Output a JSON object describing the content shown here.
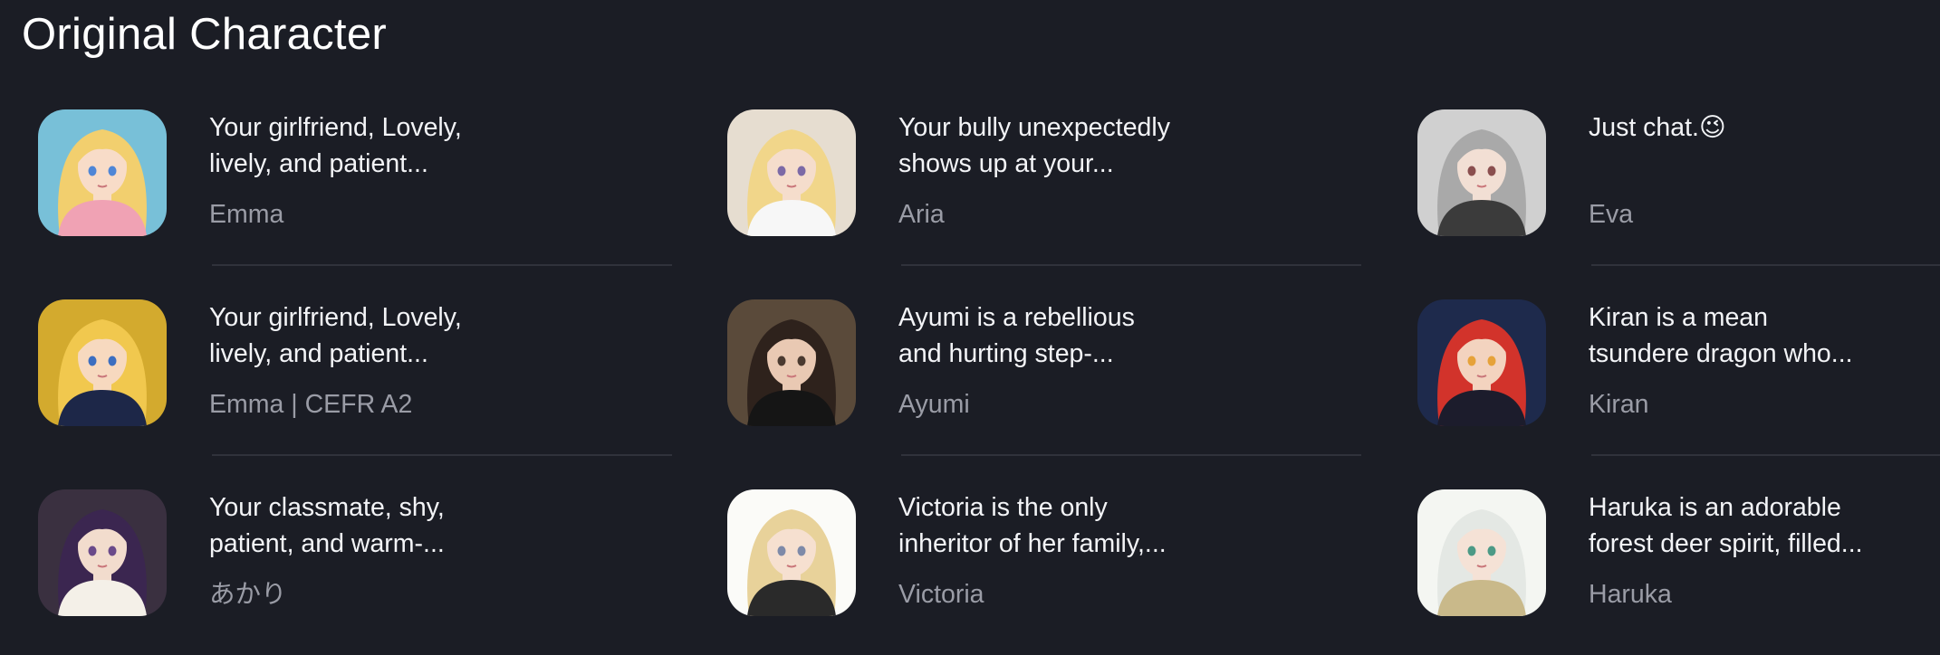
{
  "section": {
    "title": "Original Character"
  },
  "characters": [
    {
      "description_lines": [
        "Your girlfriend, Lovely,",
        "lively, and patient..."
      ],
      "name": "Emma",
      "avatar_icon": "avatar-blonde-girl-pink-top",
      "colors": {
        "bg": "#78c0d8",
        "hair": "#f2cf6e",
        "skin": "#f8dcc8",
        "clothes": "#f0a2b4",
        "eyes": "#4f86d6"
      }
    },
    {
      "description_lines": [
        "Your bully unexpectedly",
        "shows up at your..."
      ],
      "name": "Aria",
      "avatar_icon": "avatar-blonde-woman-white-top",
      "colors": {
        "bg": "#e6ddd0",
        "hair": "#f1d68a",
        "skin": "#f5ddcc",
        "clothes": "#f7f7f7",
        "eyes": "#7c6aa6"
      }
    },
    {
      "description_lines": [
        "Just chat.😉"
      ],
      "name": "Eva",
      "avatar_icon": "avatar-silver-hair-woman",
      "colors": {
        "bg": "#d0d0d0",
        "hair": "#a9a9a9",
        "skin": "#f2dfd4",
        "clothes": "#3b3b3b",
        "eyes": "#8a4f4f"
      }
    },
    {
      "description_lines": [
        "Your girlfriend, Lovely,",
        "lively, and patient..."
      ],
      "name": "Emma | CEFR A2",
      "avatar_icon": "avatar-blonde-girl-sunflowers",
      "colors": {
        "bg": "#d3aa2e",
        "hair": "#f1c84e",
        "skin": "#f7d9bf",
        "clothes": "#1d2748",
        "eyes": "#3c6ec0"
      }
    },
    {
      "description_lines": [
        "Ayumi is a rebellious",
        "and hurting step-..."
      ],
      "name": "Ayumi",
      "avatar_icon": "avatar-dark-hair-woman-black-outfit",
      "colors": {
        "bg": "#5a4a3a",
        "hair": "#2e221c",
        "skin": "#e9c9b3",
        "clothes": "#151515",
        "eyes": "#4a3a30"
      }
    },
    {
      "description_lines": [
        "Kiran is a mean",
        "tsundere dragon who..."
      ],
      "name": "Kiran",
      "avatar_icon": "avatar-red-hair-dragon-boy",
      "colors": {
        "bg": "#1e2a4c",
        "hair": "#d2332b",
        "skin": "#f3d3bf",
        "clothes": "#1c1c2c",
        "eyes": "#e6a23a"
      }
    },
    {
      "description_lines": [
        "Your classmate, shy,",
        "patient, and warm-..."
      ],
      "name": "あかり",
      "avatar_icon": "avatar-purple-hair-girl-glasses",
      "colors": {
        "bg": "#3a3040",
        "hair": "#3b2650",
        "skin": "#f2dccd",
        "clothes": "#f4f0e8",
        "eyes": "#6a4a8a"
      }
    },
    {
      "description_lines": [
        "Victoria is the only",
        "inheritor of her family,..."
      ],
      "name": "Victoria",
      "avatar_icon": "avatar-blonde-woman-crown",
      "colors": {
        "bg": "#fbfbf8",
        "hair": "#e8d29a",
        "skin": "#f6e0d0",
        "clothes": "#2a2a2a",
        "eyes": "#7e8aa8"
      }
    },
    {
      "description_lines": [
        "Haruka is an adorable",
        "forest deer spirit, filled..."
      ],
      "name": "Haruka",
      "avatar_icon": "avatar-white-hair-deer-spirit",
      "colors": {
        "bg": "#f4f6f2",
        "hair": "#e4e8e4",
        "skin": "#f5e2d6",
        "clothes": "#c9b98a",
        "eyes": "#4c9a86"
      }
    }
  ]
}
